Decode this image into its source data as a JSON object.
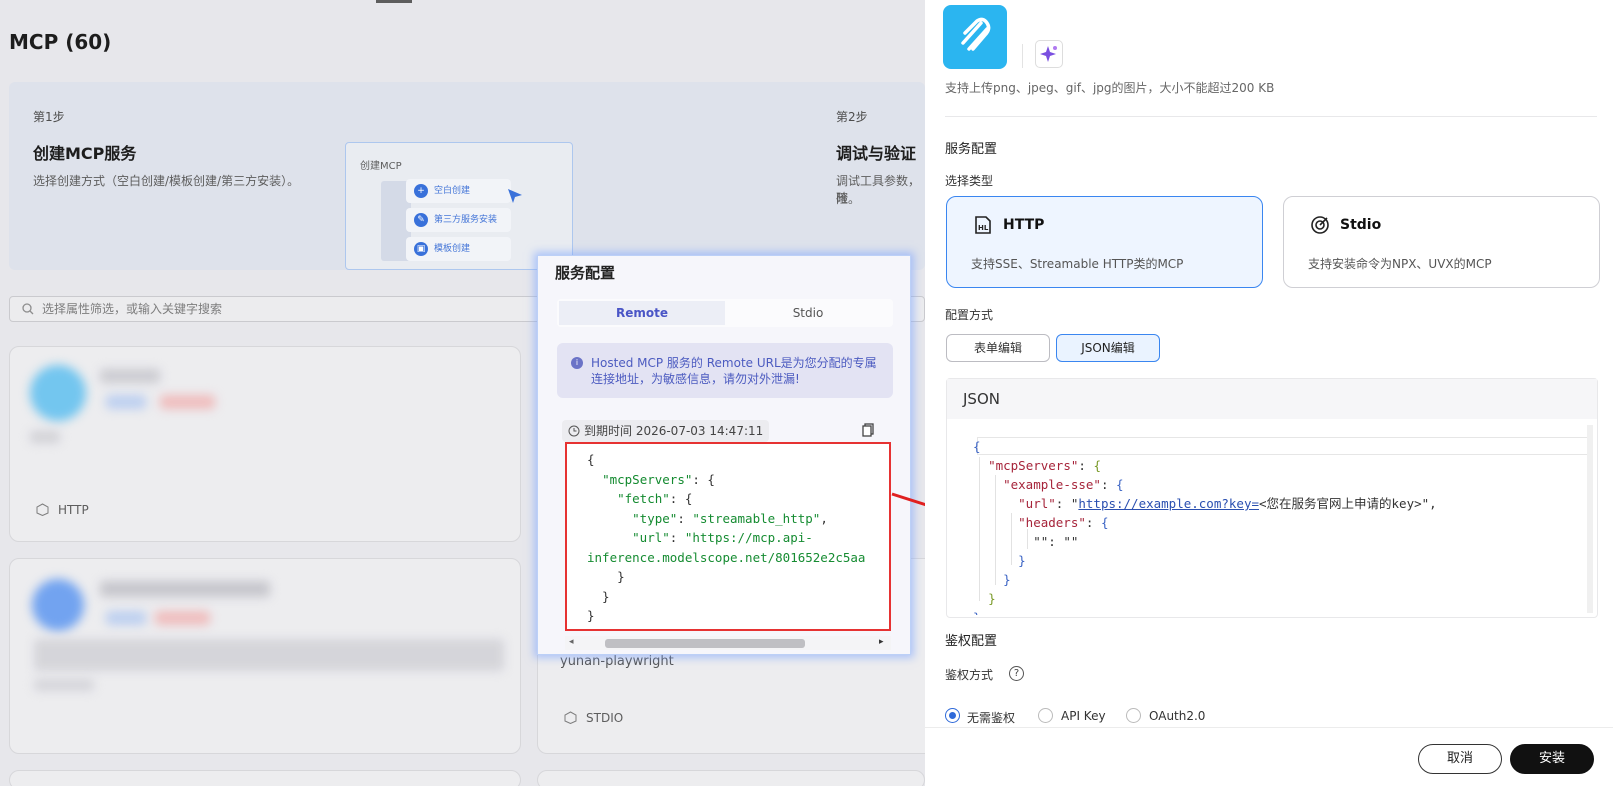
{
  "background_page": {
    "title": "MCP (60)",
    "steps": [
      {
        "num": "第1步",
        "title": "创建MCP服务",
        "desc": "选择创建方式（空白创建/模板创建/第三方安装）。"
      },
      {
        "num": "第2步",
        "title": "调试与验证",
        "desc_line1": "调试工具参数，確",
        "desc_line2": "险。"
      }
    ],
    "preview": {
      "title": "创建MCP",
      "items": [
        "空白创建",
        "第三方服务安装",
        "模板创建"
      ]
    },
    "search_placeholder": "选择属性筛选，或输入关键字搜索",
    "cards": [
      {
        "type": "HTTP"
      },
      {
        "type": "STDIO",
        "name": "yunan-playwright"
      }
    ]
  },
  "popup": {
    "title": "服务配置",
    "tabs": [
      "Remote",
      "Stdio"
    ],
    "active_tab": "Remote",
    "info": "Hosted MCP 服务的 Remote URL是为您分配的专属连接地址，为敏感信息，请勿对外泄漏!",
    "expire": "到期时间 2026-07-03 14:47:11",
    "code": {
      "key_servers": "\"mcpServers\"",
      "key_fetch": "\"fetch\"",
      "key_type": "\"type\"",
      "val_type": "\"streamable_http\"",
      "key_url": "\"url\"",
      "val_url_1": "\"https://mcp.api-",
      "val_url_2": "inference.modelscope.net/801652e2c5aa"
    }
  },
  "drawer": {
    "upload_hint": "支持上传png、jpeg、gif、jpg的图片，大小不能超过200 KB",
    "service_config": "服务配置",
    "select_type": "选择类型",
    "types": [
      {
        "name": "HTTP",
        "desc": "支持SSE、Streamable HTTP类的MCP",
        "selected": true
      },
      {
        "name": "Stdio",
        "desc": "支持安装命令为NPX、UVX的MCP",
        "selected": false
      }
    ],
    "config_method": "配置方式",
    "methods": [
      "表单编辑",
      "JSON编辑"
    ],
    "active_method": "JSON编辑",
    "json_label": "JSON",
    "json": {
      "key_servers": "\"mcpServers\"",
      "key_example": "\"example-sse\"",
      "key_url": "\"url\"",
      "url_link": "https://example.com?key=",
      "url_rest": "<您在服务官网上申请的key>\"",
      "key_headers": "\"headers\"",
      "empty_pair": "\"\": \"\""
    },
    "auth_config": "鉴权配置",
    "auth_method": "鉴权方式",
    "auth_options": [
      "无需鉴权",
      "API Key",
      "OAuth2.0"
    ],
    "selected_auth": "无需鉴权",
    "cancel": "取消",
    "install": "安装"
  },
  "colors": {
    "accent": "#2f6ad9",
    "highlight_red": "#e63232",
    "json_green": "#138a2f",
    "selected_card_bg": "#eef5ff"
  }
}
